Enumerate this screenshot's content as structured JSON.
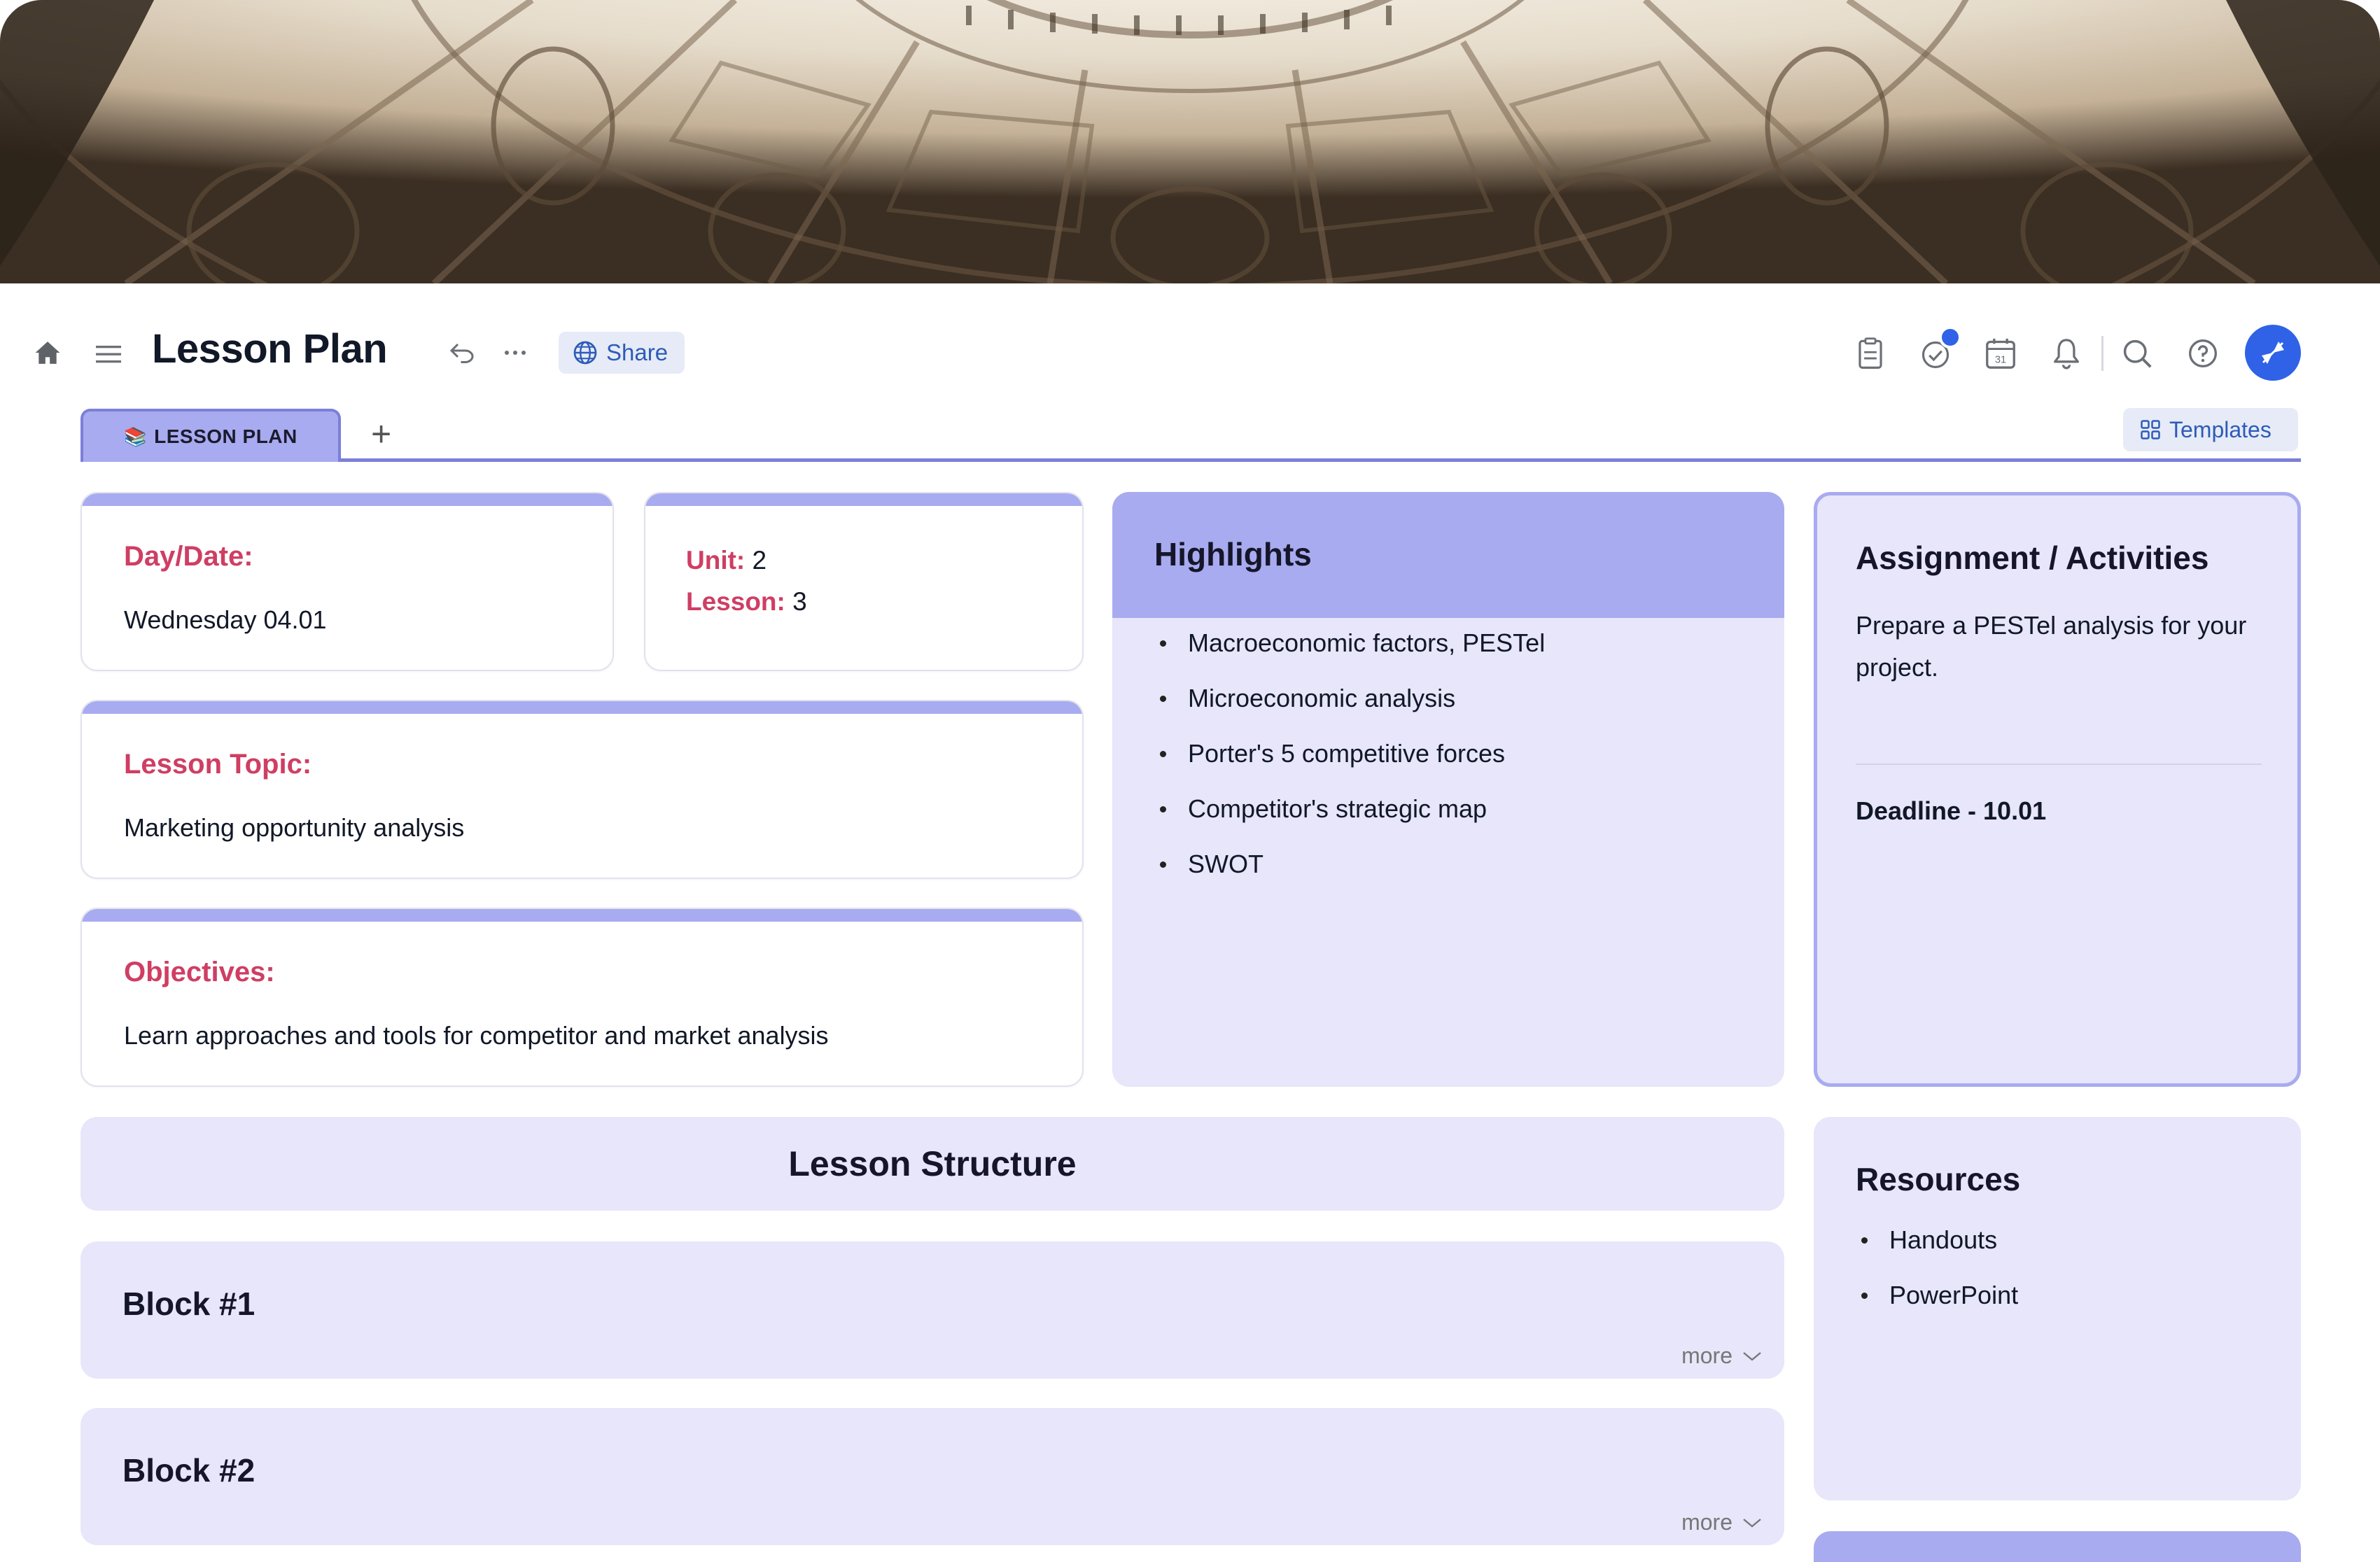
{
  "header": {
    "title": "Lesson Plan",
    "share_label": "Share",
    "icons": [
      "home-icon",
      "menu-icon",
      "undo-icon",
      "more-icon",
      "globe-icon",
      "notes-icon",
      "tasks-icon",
      "calendar-icon",
      "bell-icon",
      "search-icon",
      "help-icon"
    ],
    "calendar_day": "31"
  },
  "tabs": {
    "active_label": "LESSON PLAN",
    "active_emoji": "📚",
    "add_label": "+",
    "templates_label": "Templates"
  },
  "day_date": {
    "label": "Day/Date:",
    "value": "Wednesday 04.01"
  },
  "unit": {
    "unit_label": "Unit:",
    "unit_value": "2",
    "lesson_label": "Lesson:",
    "lesson_value": "3"
  },
  "lesson_topic": {
    "label": "Lesson Topic:",
    "value": "Marketing opportunity analysis"
  },
  "objectives": {
    "label": "Objectives:",
    "value": "Learn approaches and tools for competitor and market analysis"
  },
  "highlights": {
    "title": "Highlights",
    "items": [
      "Macroeconomic factors, PESTel",
      "Microeconomic analysis",
      "Porter's 5 competitive forces",
      "Competitor's strategic map",
      "SWOT"
    ]
  },
  "assignment": {
    "title": "Assignment / Activities",
    "description": "Prepare a PESTel analysis for your project.",
    "deadline": "Deadline - 10.01"
  },
  "lesson_structure": {
    "title": "Lesson Structure",
    "blocks": [
      {
        "title": "Block #1",
        "more_label": "more"
      },
      {
        "title": "Block #2",
        "more_label": "more"
      }
    ]
  },
  "resources": {
    "title": "Resources",
    "items": [
      {
        "label": "Handouts"
      },
      {
        "label": "PowerPoint"
      }
    ]
  },
  "colors": {
    "accent": "#a8abef",
    "accent_dark": "#7c7fd8",
    "panel": "#e7e6fa",
    "label_red": "#cf3e63",
    "brand_blue": "#2f62e6",
    "link": "#4a4ab8"
  }
}
